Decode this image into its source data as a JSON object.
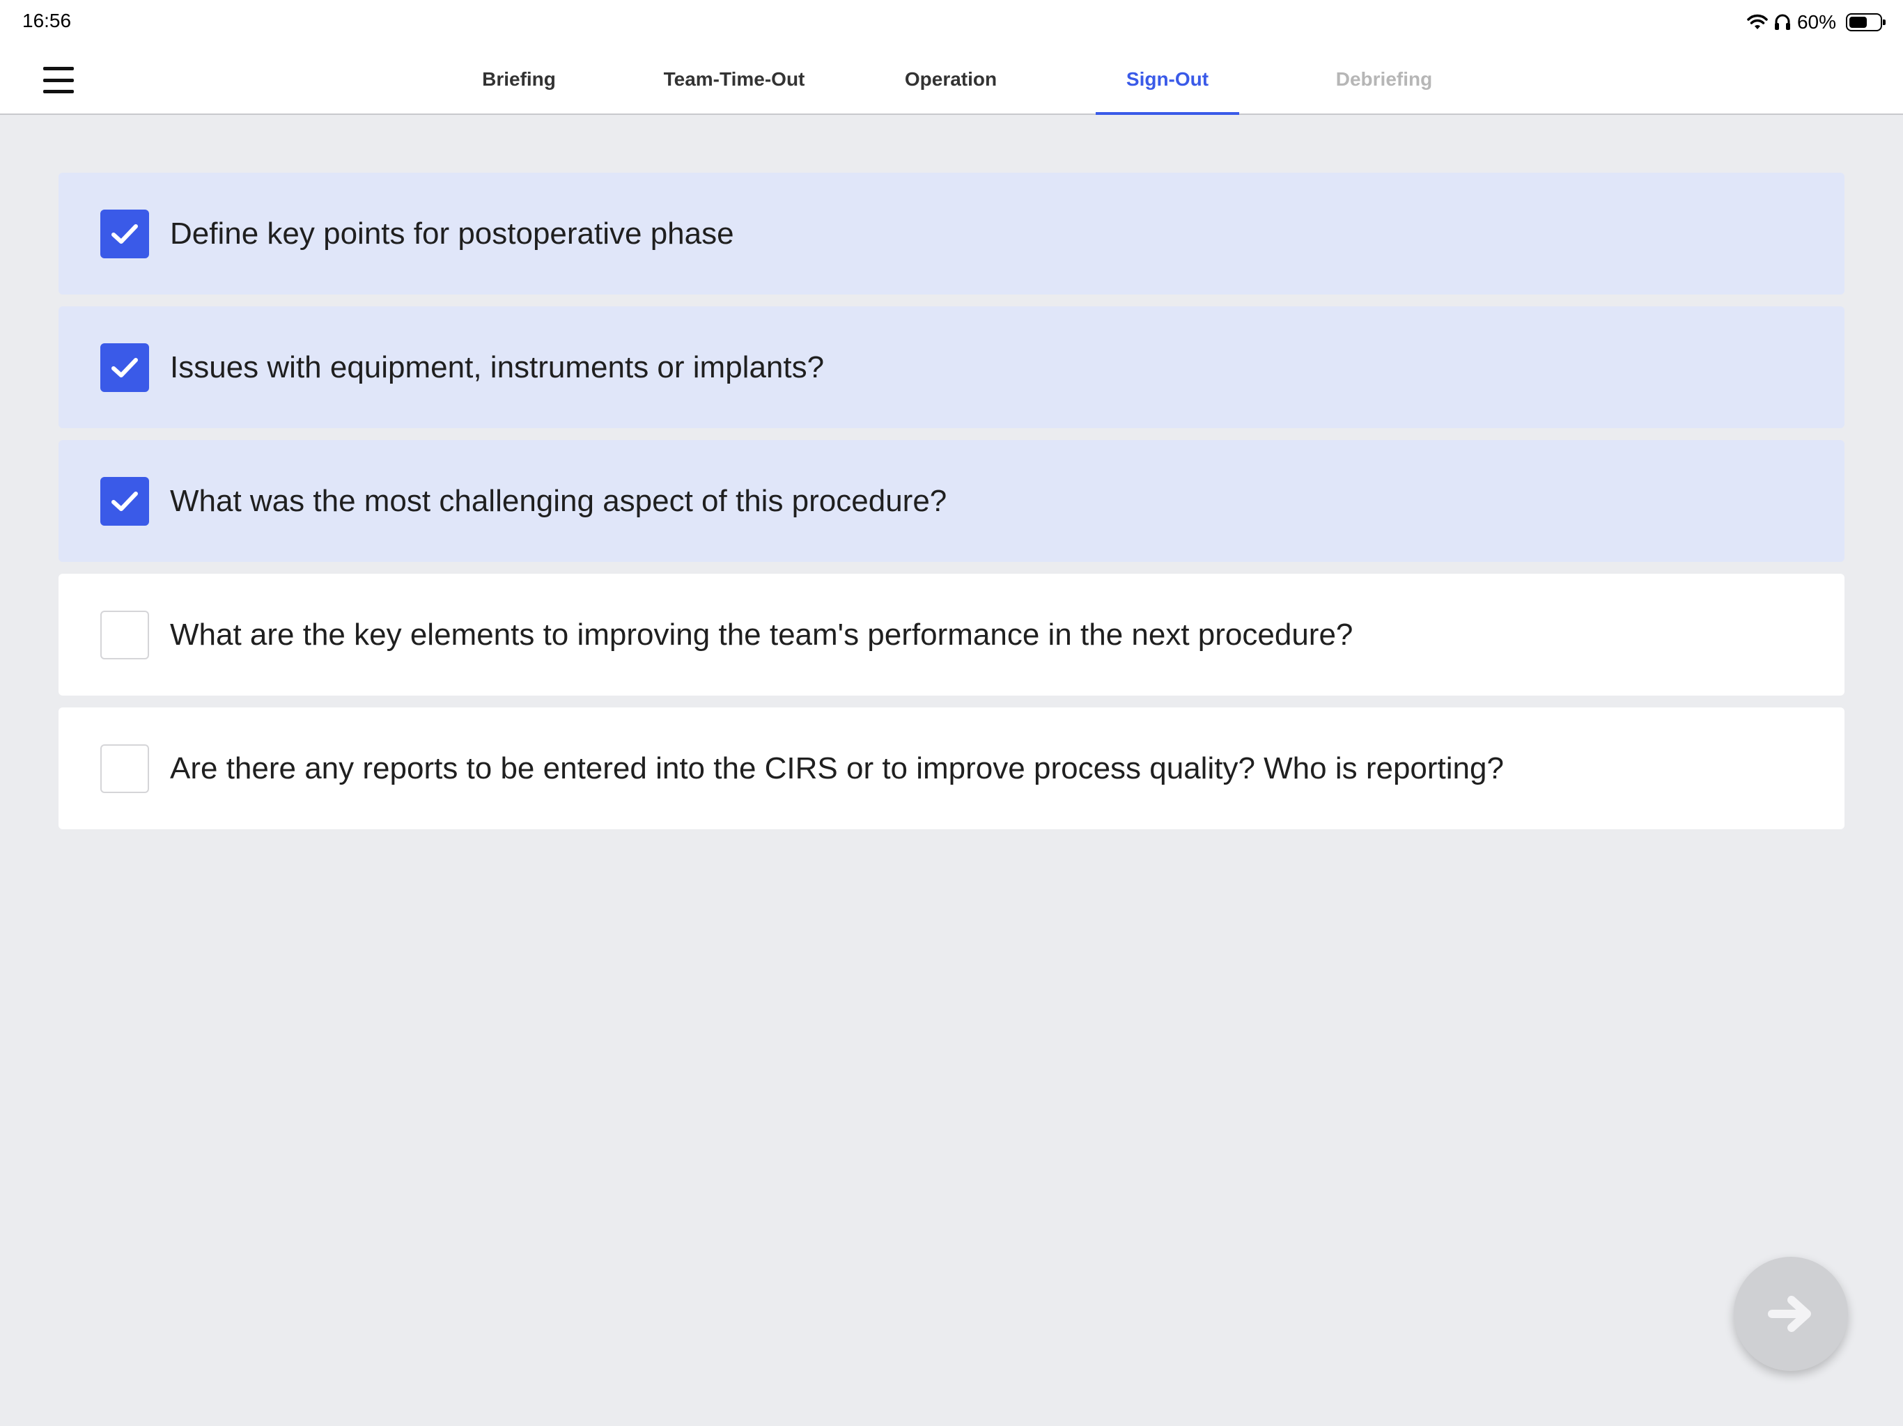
{
  "status_bar": {
    "time": "16:56",
    "battery_percent_label": "60%",
    "battery_level": 0.6
  },
  "header": {
    "menu_icon": "hamburger-menu-icon",
    "tabs": [
      {
        "label": "Briefing",
        "state": "normal"
      },
      {
        "label": "Team-Time-Out",
        "state": "normal"
      },
      {
        "label": "Operation",
        "state": "normal"
      },
      {
        "label": "Sign-Out",
        "state": "active"
      },
      {
        "label": "Debriefing",
        "state": "disabled"
      }
    ],
    "accent_color": "#3a5ae8"
  },
  "checklist": {
    "items": [
      {
        "label": "Define key points for postoperative phase",
        "checked": true
      },
      {
        "label": "Issues with equipment, instruments or implants?",
        "checked": true
      },
      {
        "label": "What was the most challenging aspect of this procedure?",
        "checked": true
      },
      {
        "label": "What are the key elements to improving the team's performance in the next procedure?",
        "checked": false
      },
      {
        "label": "Are there any reports to be entered into the CIRS or to improve process quality? Who is reporting?",
        "checked": false
      }
    ]
  },
  "next_button": {
    "icon": "arrow-right-icon",
    "enabled": false
  }
}
